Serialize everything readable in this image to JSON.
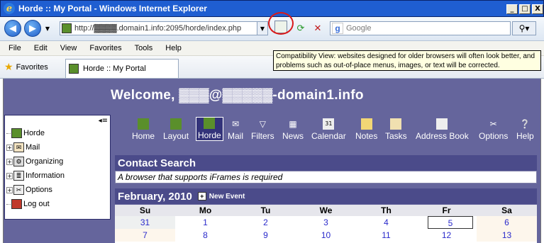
{
  "window": {
    "title": "Horde :: My Portal - Windows Internet Explorer",
    "minimize": "_",
    "maximize": "□",
    "close": "X"
  },
  "toolbar": {
    "url": "http://▓▓▓▓.domain1.info:2095/horde/index.php",
    "search_placeholder": "Google"
  },
  "menu": [
    "File",
    "Edit",
    "View",
    "Favorites",
    "Tools",
    "Help"
  ],
  "favorites": {
    "label": "Favorites",
    "tab_title": "Horde :: My Portal"
  },
  "tooltip": "Compatibility View: websites designed for older browsers will often look better, and problems such as out-of-place menus, images, or text will be corrected.",
  "portal": {
    "welcome": "Welcome, ▓▓▓@▓▓▓▓▓-domain1.info",
    "sidebar": [
      {
        "label": "Horde",
        "icon": "horde-icon"
      },
      {
        "label": "Mail",
        "icon": "mail-icon"
      },
      {
        "label": "Organizing",
        "icon": "organizing-icon"
      },
      {
        "label": "Information",
        "icon": "information-icon"
      },
      {
        "label": "Options",
        "icon": "options-icon"
      },
      {
        "label": "Log out",
        "icon": "logout-icon"
      }
    ],
    "nav": [
      {
        "label": "Home",
        "icon": "home-icon"
      },
      {
        "label": "Layout",
        "icon": "layout-icon"
      },
      {
        "label": "Horde",
        "icon": "horde-icon"
      },
      {
        "label": "Mail",
        "icon": "mail-icon"
      },
      {
        "label": "Filters",
        "icon": "filters-icon"
      },
      {
        "label": "News",
        "icon": "news-icon"
      },
      {
        "label": "Calendar",
        "icon": "calendar-icon"
      },
      {
        "label": "Notes",
        "icon": "notes-icon"
      },
      {
        "label": "Tasks",
        "icon": "tasks-icon"
      },
      {
        "label": "Address Book",
        "icon": "address-book-icon"
      },
      {
        "label": "Options",
        "icon": "options-icon"
      },
      {
        "label": "Help",
        "icon": "help-icon"
      }
    ],
    "contact_search": {
      "title": "Contact Search",
      "message": "A browser that supports iFrames is required"
    },
    "calendar": {
      "month": "February, 2010",
      "new_event": "New Event",
      "days": [
        "Su",
        "Mo",
        "Tu",
        "We",
        "Th",
        "Fr",
        "Sa"
      ],
      "weeks": [
        [
          "31",
          "1",
          "2",
          "3",
          "4",
          "5",
          "6"
        ],
        [
          "7",
          "8",
          "9",
          "10",
          "11",
          "12",
          "13"
        ]
      ]
    }
  }
}
